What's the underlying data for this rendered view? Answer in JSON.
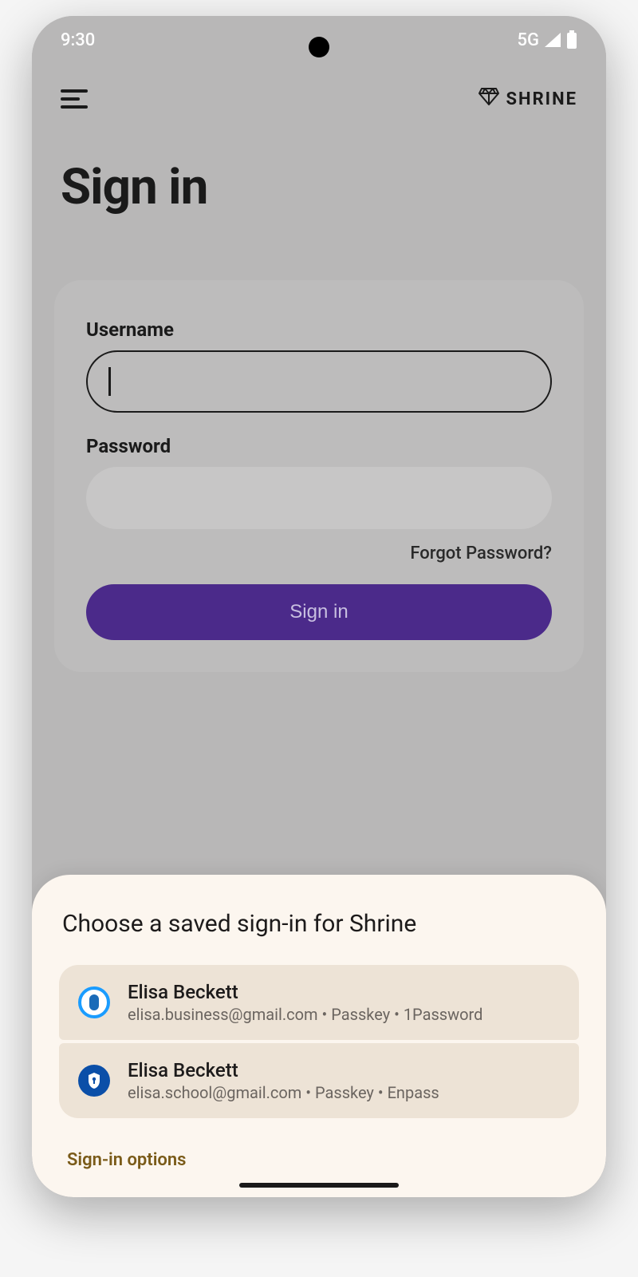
{
  "status": {
    "time": "9:30",
    "network": "5G"
  },
  "header": {
    "brand": "SHRINE"
  },
  "page": {
    "title": "Sign in"
  },
  "form": {
    "username_label": "Username",
    "username_value": "",
    "password_label": "Password",
    "password_value": "",
    "forgot": "Forgot Password?",
    "submit": "Sign in"
  },
  "sheet": {
    "title": "Choose a saved sign-in for Shrine",
    "credentials": [
      {
        "icon": "1password-icon",
        "name": "Elisa Beckett",
        "detail": "elisa.business@gmail.com • Passkey • 1Password"
      },
      {
        "icon": "enpass-icon",
        "name": "Elisa Beckett",
        "detail": "elisa.school@gmail.com • Passkey • Enpass"
      }
    ],
    "options": "Sign-in options"
  }
}
